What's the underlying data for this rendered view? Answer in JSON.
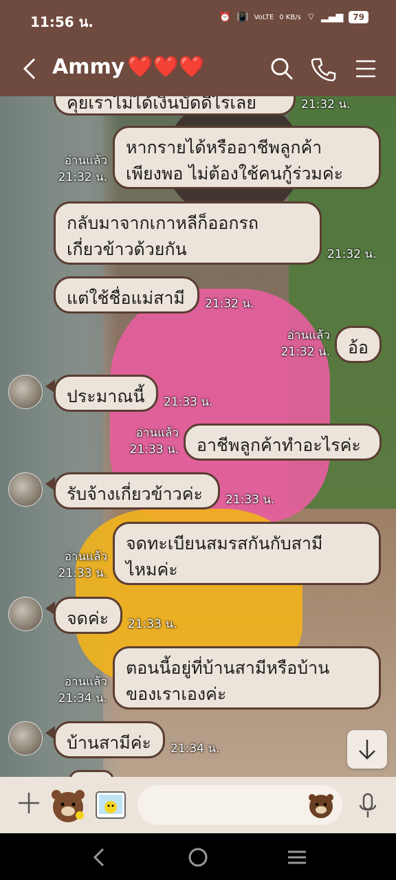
{
  "status": {
    "time": "11:56 น.",
    "battery": "79",
    "net": "0 KB/s",
    "volte": "VoLTE"
  },
  "header": {
    "title": "Ammy",
    "hearts": "❤️❤️❤️",
    "icons": [
      "back-icon",
      "search-icon",
      "phone-icon",
      "menu-icon"
    ]
  },
  "messages": [
    {
      "side": "in",
      "text": "คุยเราไม่ได้เงินบัดดีไรเลย",
      "time": "21:32 น."
    },
    {
      "side": "out",
      "read": "อ่านแล้ว",
      "time": "21:32 น.",
      "lines": [
        "หากรายได้หรืออาชีพลูกค้า",
        "เพียงพอ ไม่ต้องใช้คนกู้ร่วมค่ะ"
      ]
    },
    {
      "side": "in",
      "time": "21:32 น.",
      "lines": [
        "กลับมาจากเกาหลีก็ออกรถ",
        "เกี่ยวข้าวด้วยกัน"
      ]
    },
    {
      "side": "in",
      "time": "21:32 น.",
      "text": "แต่ใช้ชื่อแม่สามี"
    },
    {
      "side": "out",
      "read": "อ่านแล้ว",
      "time": "21:32 น.",
      "text": "อ้อ"
    },
    {
      "side": "in",
      "time": "21:33 น.",
      "text": "ประมาณนี้"
    },
    {
      "side": "out",
      "read": "อ่านแล้ว",
      "time": "21:33 น.",
      "text": "อาชีพลูกค้าทำอะไรค่ะ"
    },
    {
      "side": "in",
      "time": "21:33 น.",
      "text": "รับจ้างเกี่ยวข้าวค่ะ"
    },
    {
      "side": "out",
      "read": "อ่านแล้ว",
      "time": "21:33 น.",
      "lines": [
        "จดทะเบียนสมรสกันกับสามี",
        "ไหมค่ะ"
      ]
    },
    {
      "side": "in",
      "time": "21:33 น.",
      "text": "จดค่ะ"
    },
    {
      "side": "out",
      "read": "อ่านแล้ว",
      "time": "21:34 น.",
      "lines": [
        "ตอนนี้อยู่ที่บ้านสามีหรือบ้าน",
        "ของเราเองค่ะ"
      ]
    },
    {
      "side": "in",
      "time": "21:34 น.",
      "text": "บ้านสามีค่ะ"
    }
  ],
  "colors": {
    "header": "#6f4a3e",
    "bubble": "#ece4da",
    "border": "#5a3d32"
  }
}
